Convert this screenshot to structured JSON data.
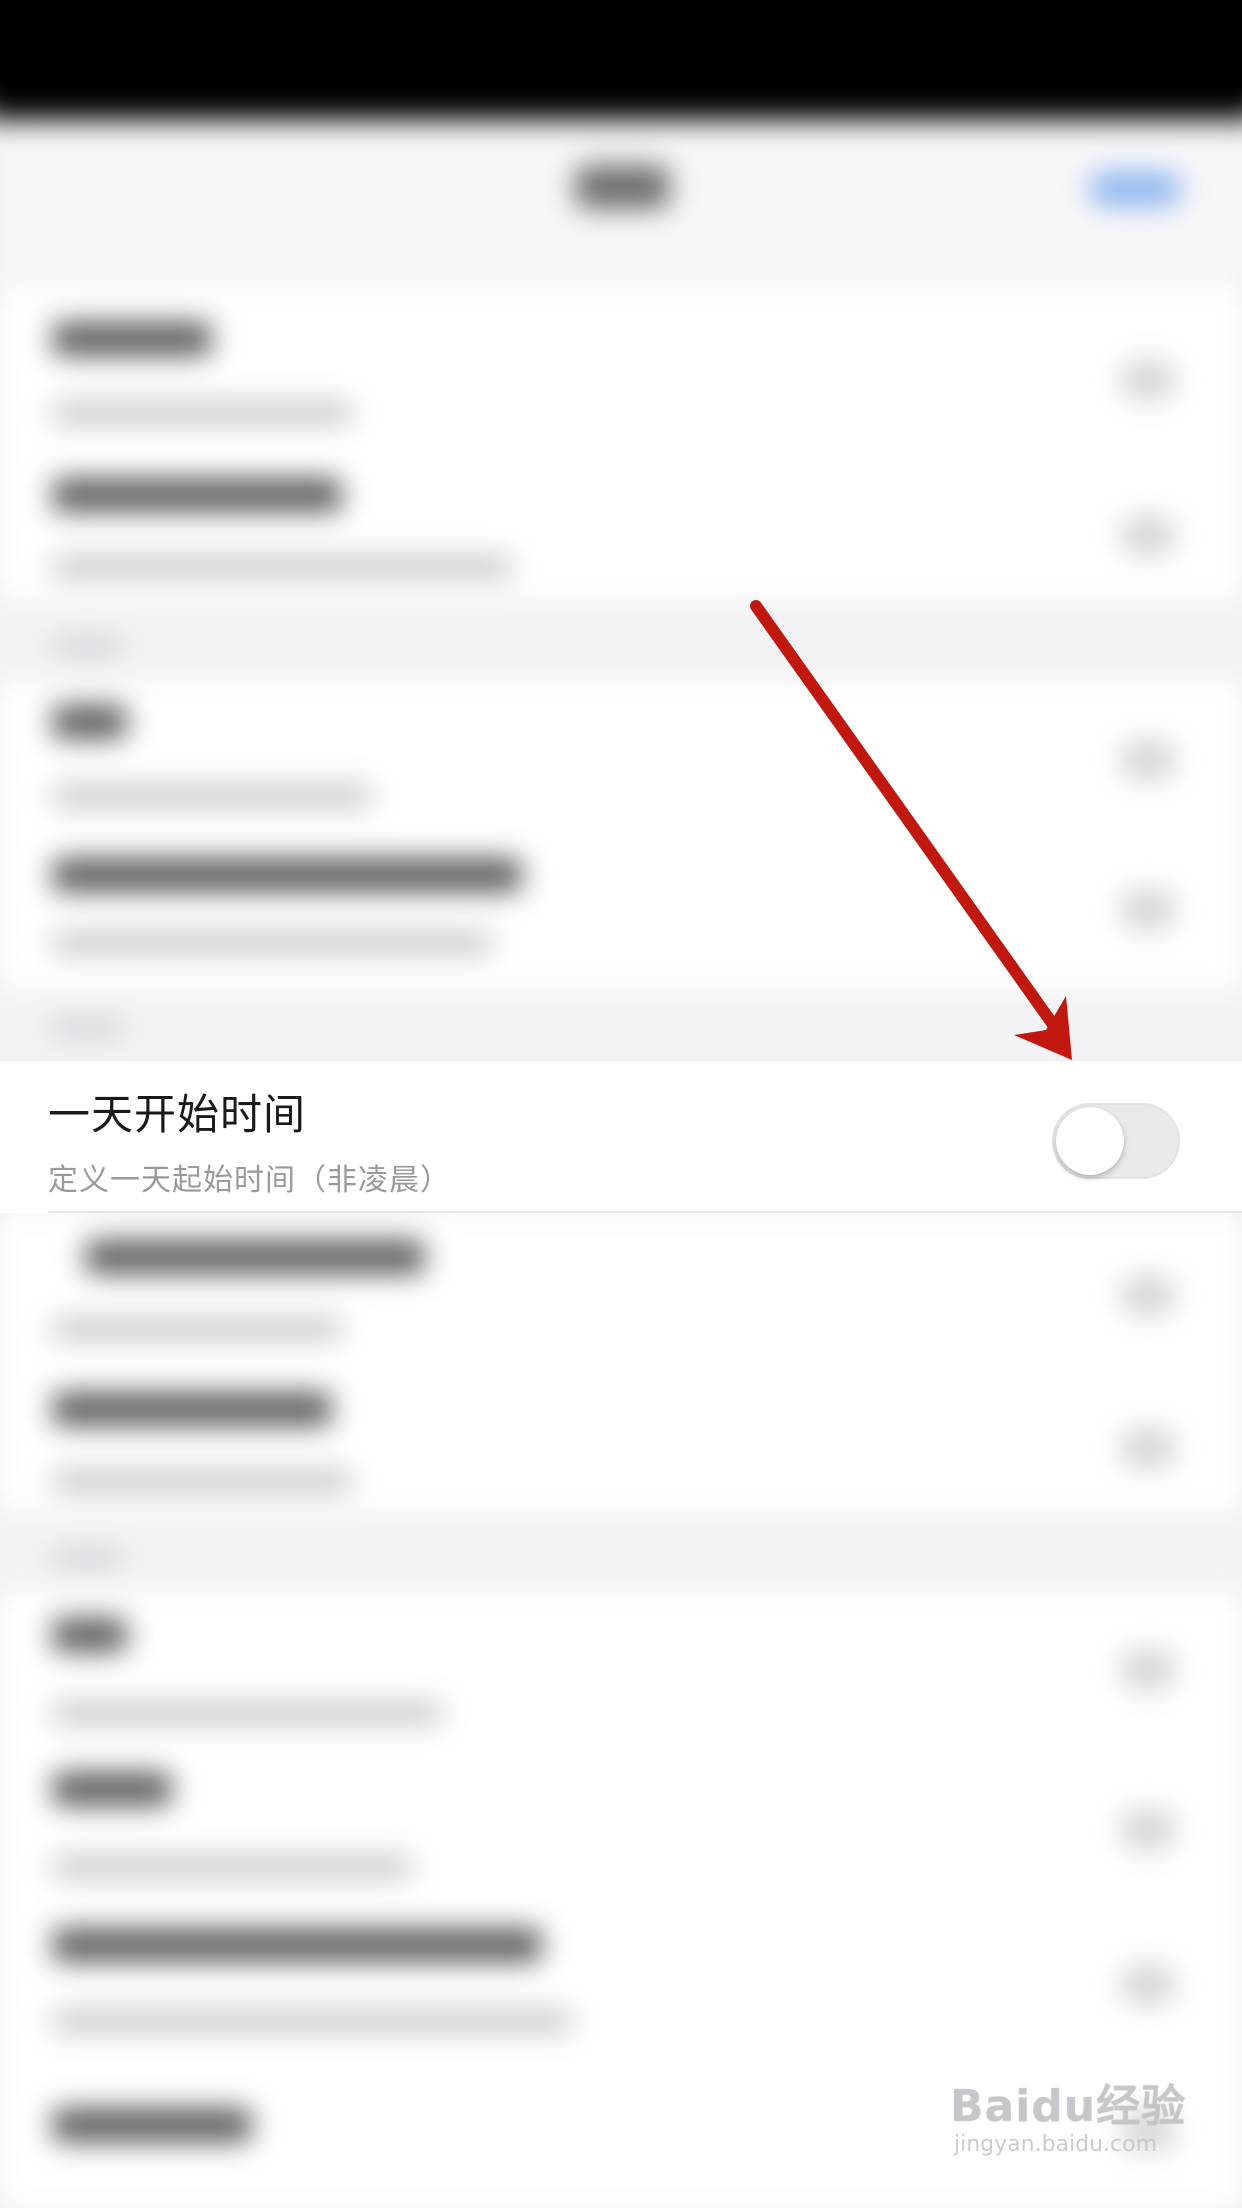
{
  "setting_row": {
    "title": "一天开始时间",
    "subtitle": "定义一天起始时间（非凌晨）",
    "toggle_state": "off"
  },
  "watermark": {
    "logo": "Baidu经验",
    "url": "jingyan.baidu.com"
  },
  "colors": {
    "arrow": "#c0180f",
    "toggle_track": "#e9e9ea",
    "nav_accent": "#8cb3ee"
  }
}
